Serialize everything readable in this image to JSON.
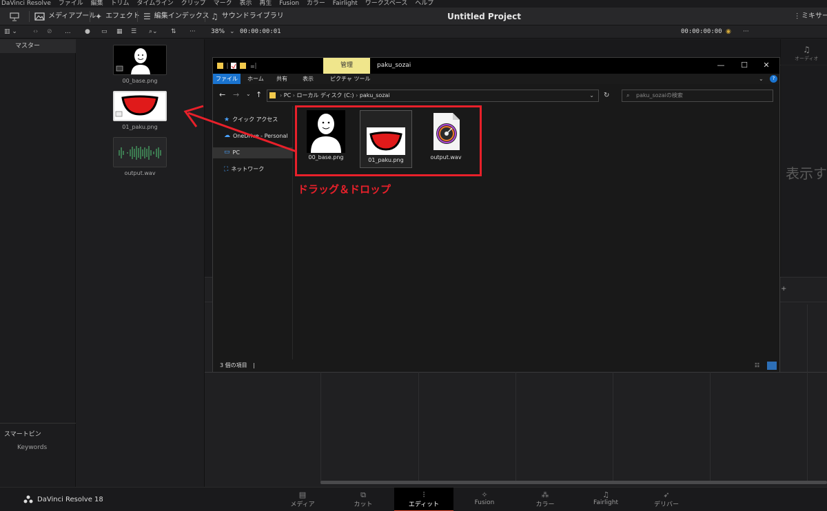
{
  "menubar": [
    "DaVinci Resolve",
    "ファイル",
    "編集",
    "トリム",
    "タイムライン",
    "クリップ",
    "マーク",
    "表示",
    "再生",
    "Fusion",
    "カラー",
    "Fairlight",
    "ワークスペース",
    "ヘルプ"
  ],
  "toolbar": {
    "media_pool": "メディアプール",
    "effects": "エフェクト",
    "edit_index": "編集インデックス",
    "sound_library": "サウンドライブラリ",
    "project_title": "Untitled Project",
    "mixer": "ミキサー"
  },
  "subbar": {
    "dots": "...",
    "zoom": "38%",
    "timecode_left": "00:00:00:01",
    "timecode_right": "00:00:00:00",
    "more": "···"
  },
  "left_panel": {
    "master": "マスター",
    "smart_bin": "スマートビン",
    "keywords": "Keywords"
  },
  "media_pool": {
    "clips": [
      {
        "name": "00_base.png",
        "type": "image"
      },
      {
        "name": "01_paku.png",
        "type": "image"
      },
      {
        "name": "output.wav",
        "type": "audio"
      }
    ]
  },
  "explorer": {
    "manage_tab": "管理",
    "window_name": "paku_sozai",
    "ribbon_tabs": [
      "ファイル",
      "ホーム",
      "共有",
      "表示",
      "ピクチャ ツール"
    ],
    "path": [
      "PC",
      "ローカル ディスク (C:)",
      "paku_sozai"
    ],
    "search_placeholder": "paku_sozaiの検索",
    "nav": {
      "quick_access": "クイック アクセス",
      "onedrive": "OneDrive - Personal",
      "pc": "PC",
      "network": "ネットワーク"
    },
    "files": [
      "00_base.png",
      "01_paku.png",
      "output.wav"
    ],
    "status": "3 個の項目",
    "status_bar_glyph": "|"
  },
  "annotation": {
    "drag_drop": "ドラッグ＆ドロップ",
    "color": "#e8202a"
  },
  "right_strip": {
    "audio_label": "オーディオ",
    "display_text": "表示す"
  },
  "bottombar": {
    "brand": "DaVinci Resolve 18",
    "pages": [
      {
        "label": "メディア",
        "icon": "media-icon"
      },
      {
        "label": "カット",
        "icon": "cut-icon"
      },
      {
        "label": "エディット",
        "icon": "edit-icon",
        "active": true
      },
      {
        "label": "Fusion",
        "icon": "fusion-icon"
      },
      {
        "label": "カラー",
        "icon": "color-icon"
      },
      {
        "label": "Fairlight",
        "icon": "fairlight-icon"
      },
      {
        "label": "デリバー",
        "icon": "deliver-icon"
      }
    ]
  }
}
